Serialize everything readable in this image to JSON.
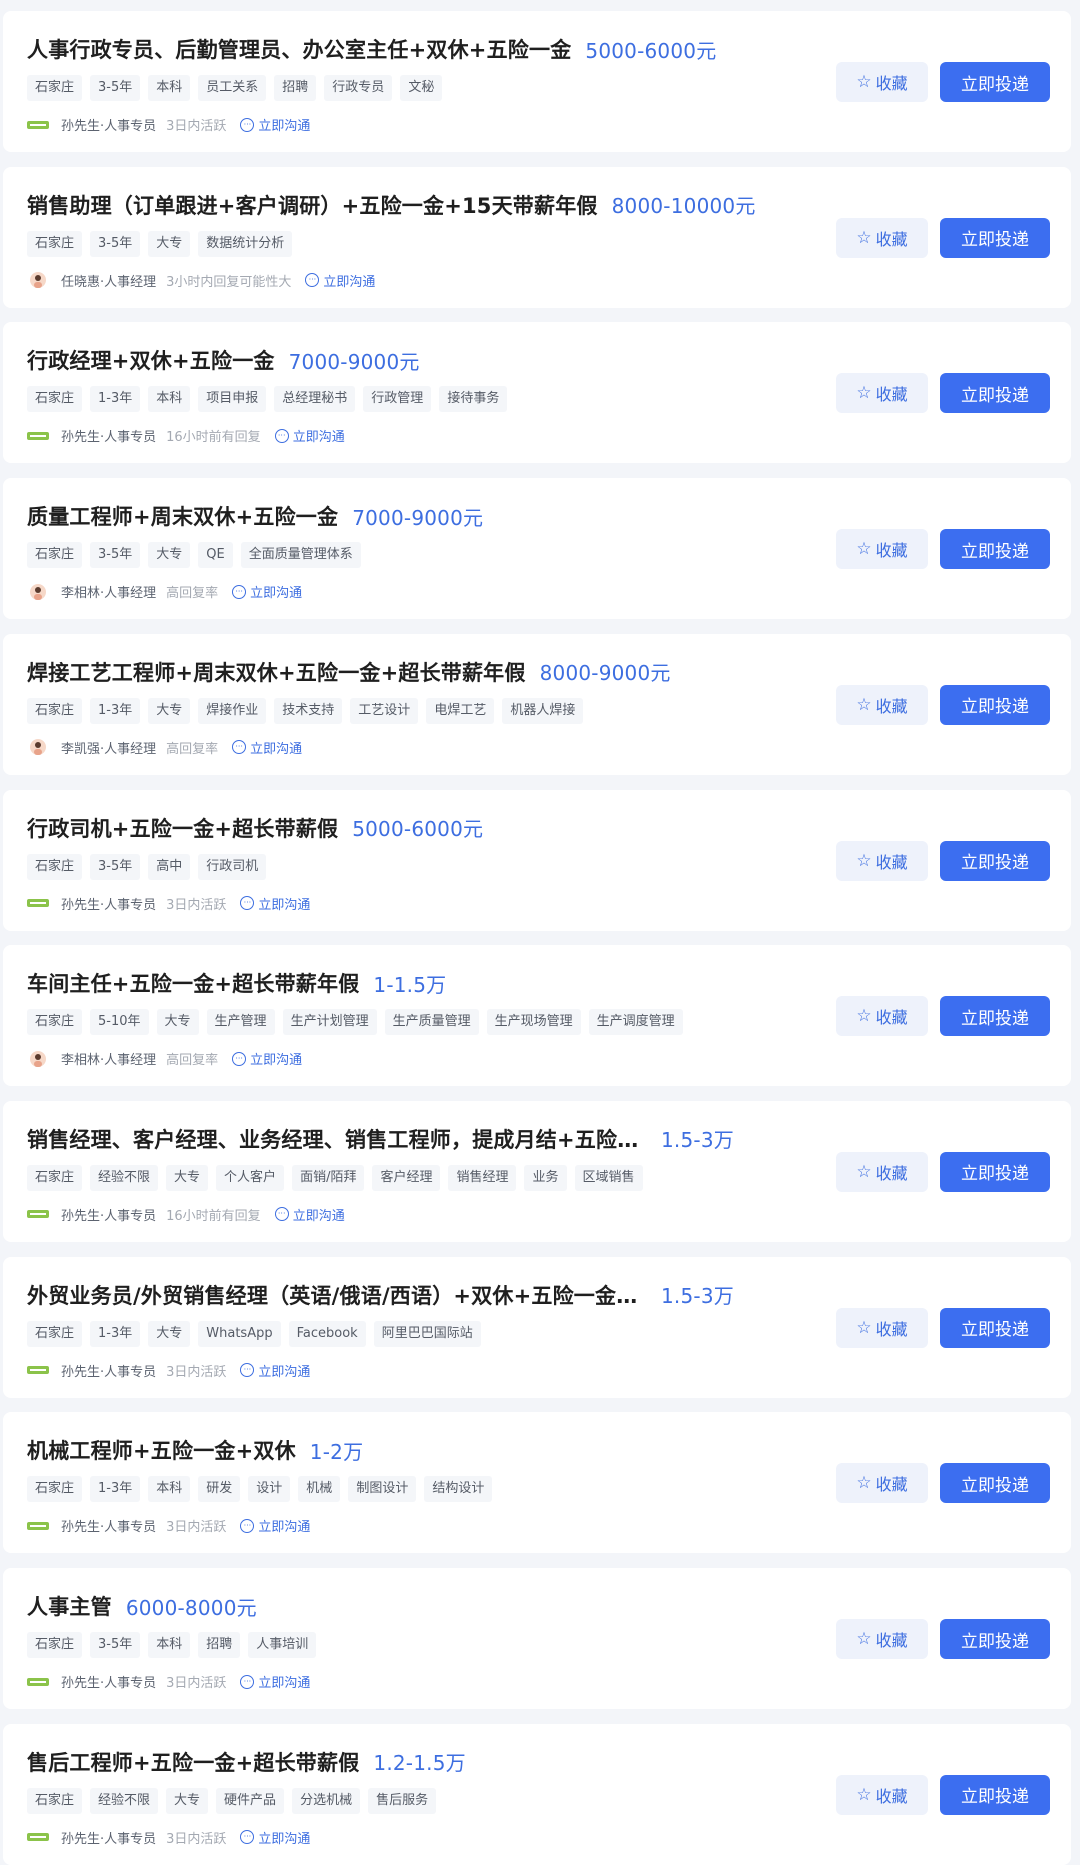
{
  "actions": {
    "favorite_label": "收藏",
    "apply_label": "立即投递",
    "chat_label": "立即沟通"
  },
  "colors": {
    "accent": "#3c6ef0",
    "salary": "#3d6ee0",
    "background": "#f3f5f9"
  },
  "jobs": [
    {
      "title": "人事行政专员、后勤管理员、办公室主任+双休+五险一金",
      "salary": "5000-6000元",
      "tags": [
        "石家庄",
        "3-5年",
        "本科",
        "员工关系",
        "招聘",
        "行政专员",
        "文秘"
      ],
      "recruiter": "孙先生·人事专员",
      "activity": "3日内活跃",
      "avatar": "company-logo"
    },
    {
      "title": "销售助理（订单跟进+客户调研）+五险一金+15天带薪年假",
      "salary": "8000-10000元",
      "tags": [
        "石家庄",
        "3-5年",
        "大专",
        "数据统计分析"
      ],
      "recruiter": "任晓惠·人事经理",
      "activity": "3小时内回复可能性大",
      "avatar": "person-avatar"
    },
    {
      "title": "行政经理+双休+五险一金",
      "salary": "7000-9000元",
      "tags": [
        "石家庄",
        "1-3年",
        "本科",
        "项目申报",
        "总经理秘书",
        "行政管理",
        "接待事务"
      ],
      "recruiter": "孙先生·人事专员",
      "activity": "16小时前有回复",
      "avatar": "company-logo"
    },
    {
      "title": "质量工程师+周末双休+五险一金",
      "salary": "7000-9000元",
      "tags": [
        "石家庄",
        "3-5年",
        "大专",
        "QE",
        "全面质量管理体系"
      ],
      "recruiter": "李相林·人事经理",
      "activity": "高回复率",
      "avatar": "person-avatar"
    },
    {
      "title": "焊接工艺工程师+周末双休+五险一金+超长带薪年假",
      "salary": "8000-9000元",
      "tags": [
        "石家庄",
        "1-3年",
        "大专",
        "焊接作业",
        "技术支持",
        "工艺设计",
        "电焊工艺",
        "机器人焊接"
      ],
      "recruiter": "李凯强·人事经理",
      "activity": "高回复率",
      "avatar": "person-avatar"
    },
    {
      "title": "行政司机+五险一金+超长带薪假",
      "salary": "5000-6000元",
      "tags": [
        "石家庄",
        "3-5年",
        "高中",
        "行政司机"
      ],
      "recruiter": "孙先生·人事专员",
      "activity": "3日内活跃",
      "avatar": "company-logo"
    },
    {
      "title": "车间主任+五险一金+超长带薪年假",
      "salary": "1-1.5万",
      "tags": [
        "石家庄",
        "5-10年",
        "大专",
        "生产管理",
        "生产计划管理",
        "生产质量管理",
        "生产现场管理",
        "生产调度管理"
      ],
      "recruiter": "李相林·人事经理",
      "activity": "高回复率",
      "avatar": "person-avatar"
    },
    {
      "title": "销售经理、客户经理、业务经理、销售工程师，提成月结+五险一金",
      "salary": "1.5-3万",
      "tags": [
        "石家庄",
        "经验不限",
        "大专",
        "个人客户",
        "面销/陌拜",
        "客户经理",
        "销售经理",
        "业务",
        "区域销售"
      ],
      "recruiter": "孙先生·人事专员",
      "activity": "16小时前有回复",
      "avatar": "company-logo"
    },
    {
      "title": "外贸业务员/外贸销售经理（英语/俄语/西语）+双休+五险一金+…",
      "salary": "1.5-3万",
      "tags": [
        "石家庄",
        "1-3年",
        "大专",
        "WhatsApp",
        "Facebook",
        "阿里巴巴国际站"
      ],
      "recruiter": "孙先生·人事专员",
      "activity": "3日内活跃",
      "avatar": "company-logo"
    },
    {
      "title": "机械工程师+五险一金+双休",
      "salary": "1-2万",
      "tags": [
        "石家庄",
        "1-3年",
        "本科",
        "研发",
        "设计",
        "机械",
        "制图设计",
        "结构设计"
      ],
      "recruiter": "孙先生·人事专员",
      "activity": "3日内活跃",
      "avatar": "company-logo"
    },
    {
      "title": "人事主管",
      "salary": "6000-8000元",
      "tags": [
        "石家庄",
        "3-5年",
        "本科",
        "招聘",
        "人事培训"
      ],
      "recruiter": "孙先生·人事专员",
      "activity": "3日内活跃",
      "avatar": "company-logo"
    },
    {
      "title": "售后工程师+五险一金+超长带薪假",
      "salary": "1.2-1.5万",
      "tags": [
        "石家庄",
        "经验不限",
        "大专",
        "硬件产品",
        "分选机械",
        "售后服务"
      ],
      "recruiter": "孙先生·人事专员",
      "activity": "3日内活跃",
      "avatar": "company-logo"
    }
  ]
}
